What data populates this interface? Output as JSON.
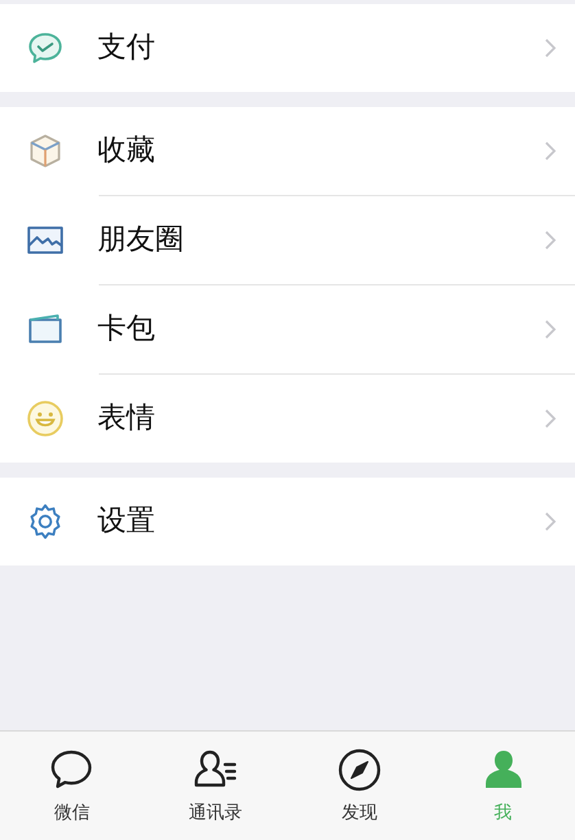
{
  "sections": [
    {
      "items": [
        {
          "label": "支付",
          "kind": "pay"
        }
      ]
    },
    {
      "items": [
        {
          "label": "收藏",
          "kind": "favorites"
        },
        {
          "label": "朋友圈",
          "kind": "moments"
        },
        {
          "label": "卡包",
          "kind": "cards"
        },
        {
          "label": "表情",
          "kind": "stickers"
        }
      ]
    },
    {
      "items": [
        {
          "label": "设置",
          "kind": "settings"
        }
      ]
    }
  ],
  "tabs": [
    {
      "label": "微信",
      "kind": "chats",
      "selected": false
    },
    {
      "label": "通讯录",
      "kind": "contacts",
      "selected": false
    },
    {
      "label": "发现",
      "kind": "discover",
      "selected": false
    },
    {
      "label": "我",
      "kind": "me",
      "selected": true
    }
  ]
}
